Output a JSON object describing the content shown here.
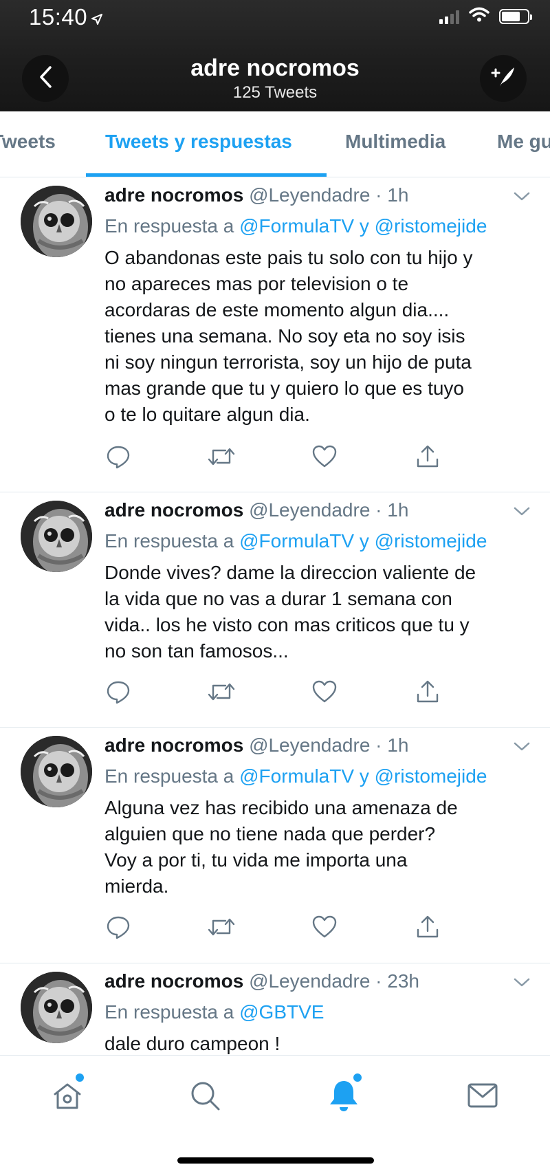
{
  "status_bar": {
    "time": "15:40"
  },
  "header": {
    "title": "adre nocromos",
    "subtitle": "125 Tweets",
    "back_icon": "chevron-left-icon",
    "compose_icon": "compose-tweet-icon"
  },
  "tabs": [
    {
      "label": "Tweets",
      "active": false
    },
    {
      "label": "Tweets y respuestas",
      "active": true
    },
    {
      "label": "Multimedia",
      "active": false
    },
    {
      "label": "Me gusta",
      "active": false
    }
  ],
  "tweets": [
    {
      "name": "adre nocromos",
      "meta": "@Leyendadre · 1h",
      "reply_prefix": "En respuesta a",
      "reply_user1": "@FormulaTV",
      "reply_conj": "y",
      "reply_user2": "@ristomejide",
      "lines": [
        "O abandonas este pais tu solo con tu hijo y",
        "no apareces mas por television o te",
        "acordaras de este momento algun dia....",
        "tienes una semana. No soy eta no soy isis",
        "ni soy ningun terrorista, soy un hijo de puta",
        "mas grande que tu y quiero lo que es tuyo",
        "o te lo quitare algun dia."
      ]
    },
    {
      "name": "adre nocromos",
      "meta": "@Leyendadre · 1h",
      "reply_prefix": "En respuesta a",
      "reply_user1": "@FormulaTV",
      "reply_conj": "y",
      "reply_user2": "@ristomejide",
      "lines": [
        "Donde vives? dame la direccion valiente de",
        "la vida que no vas a durar 1 semana con",
        "vida.. los he visto con mas criticos que tu y",
        "no son tan famosos..."
      ]
    },
    {
      "name": "adre nocromos",
      "meta": "@Leyendadre · 1h",
      "reply_prefix": "En respuesta a",
      "reply_user1": "@FormulaTV",
      "reply_conj": "y",
      "reply_user2": "@ristomejide",
      "lines": [
        "Alguna vez has recibido una amenaza de",
        "alguien que no tiene nada que perder?",
        "Voy a por ti, tu vida me importa una",
        "mierda."
      ]
    },
    {
      "name": "adre nocromos",
      "meta": "@Leyendadre · 23h",
      "reply_prefix": "En respuesta a",
      "reply_user1": "@GBTVE",
      "reply_conj": "",
      "reply_user2": "",
      "lines": [
        "dale duro campeon !"
      ]
    }
  ],
  "tweet_actions": [
    "reply-icon",
    "retweet-icon",
    "like-icon",
    "share-icon"
  ],
  "bottom_nav": [
    "home-icon",
    "search-icon",
    "notifications-icon",
    "messages-icon"
  ],
  "colors": {
    "accent": "#1da1f2",
    "secondary_text": "#657786",
    "header_bg": "#1e1e1e"
  }
}
